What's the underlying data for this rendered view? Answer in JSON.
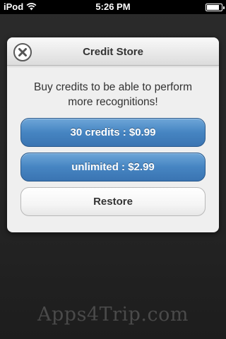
{
  "status_bar": {
    "carrier": "iPod",
    "time": "5:26 PM",
    "battery_level": 0.85
  },
  "dialog": {
    "title": "Credit Store",
    "message": "Buy credits to be able to perform more recognitions!",
    "close_icon": "close-icon",
    "buttons": [
      {
        "label": "30 credits : $0.99",
        "style": "blue"
      },
      {
        "label": "unlimited : $2.99",
        "style": "blue"
      },
      {
        "label": "Restore",
        "style": "white"
      }
    ]
  },
  "watermark": "Apps4Trip.com",
  "colors": {
    "button_blue": "#4685c2",
    "background": "#262626"
  }
}
